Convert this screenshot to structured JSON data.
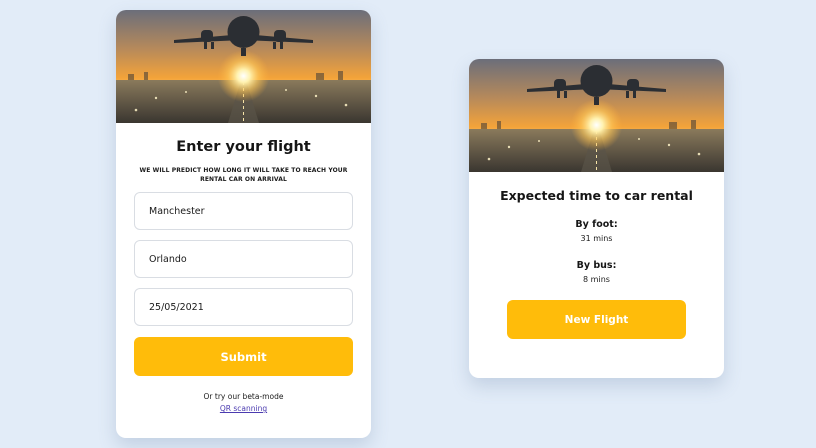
{
  "colors": {
    "page_bg": "#e2ecf8",
    "accent": "#ffbc0a",
    "link": "#4b3bb0"
  },
  "hero_image": {
    "depicts": "airplane-over-runway-sunset"
  },
  "flight_form": {
    "title": "Enter your flight",
    "subtitle": "WE WILL PREDICT HOW LONG IT WILL TAKE TO REACH YOUR RENTAL CAR ON ARRIVAL",
    "from_value": "Manchester",
    "to_value": "Orlando",
    "date_value": "25/05/2021",
    "submit_label": "Submit",
    "beta_text": "Or try our beta-mode",
    "beta_link": "QR scanning"
  },
  "result": {
    "title": "Expected time to car rental",
    "foot_label": "By foot:",
    "foot_value": "31 mins",
    "bus_label": "By bus:",
    "bus_value": "8 mins",
    "new_flight_label": "New Flight"
  }
}
